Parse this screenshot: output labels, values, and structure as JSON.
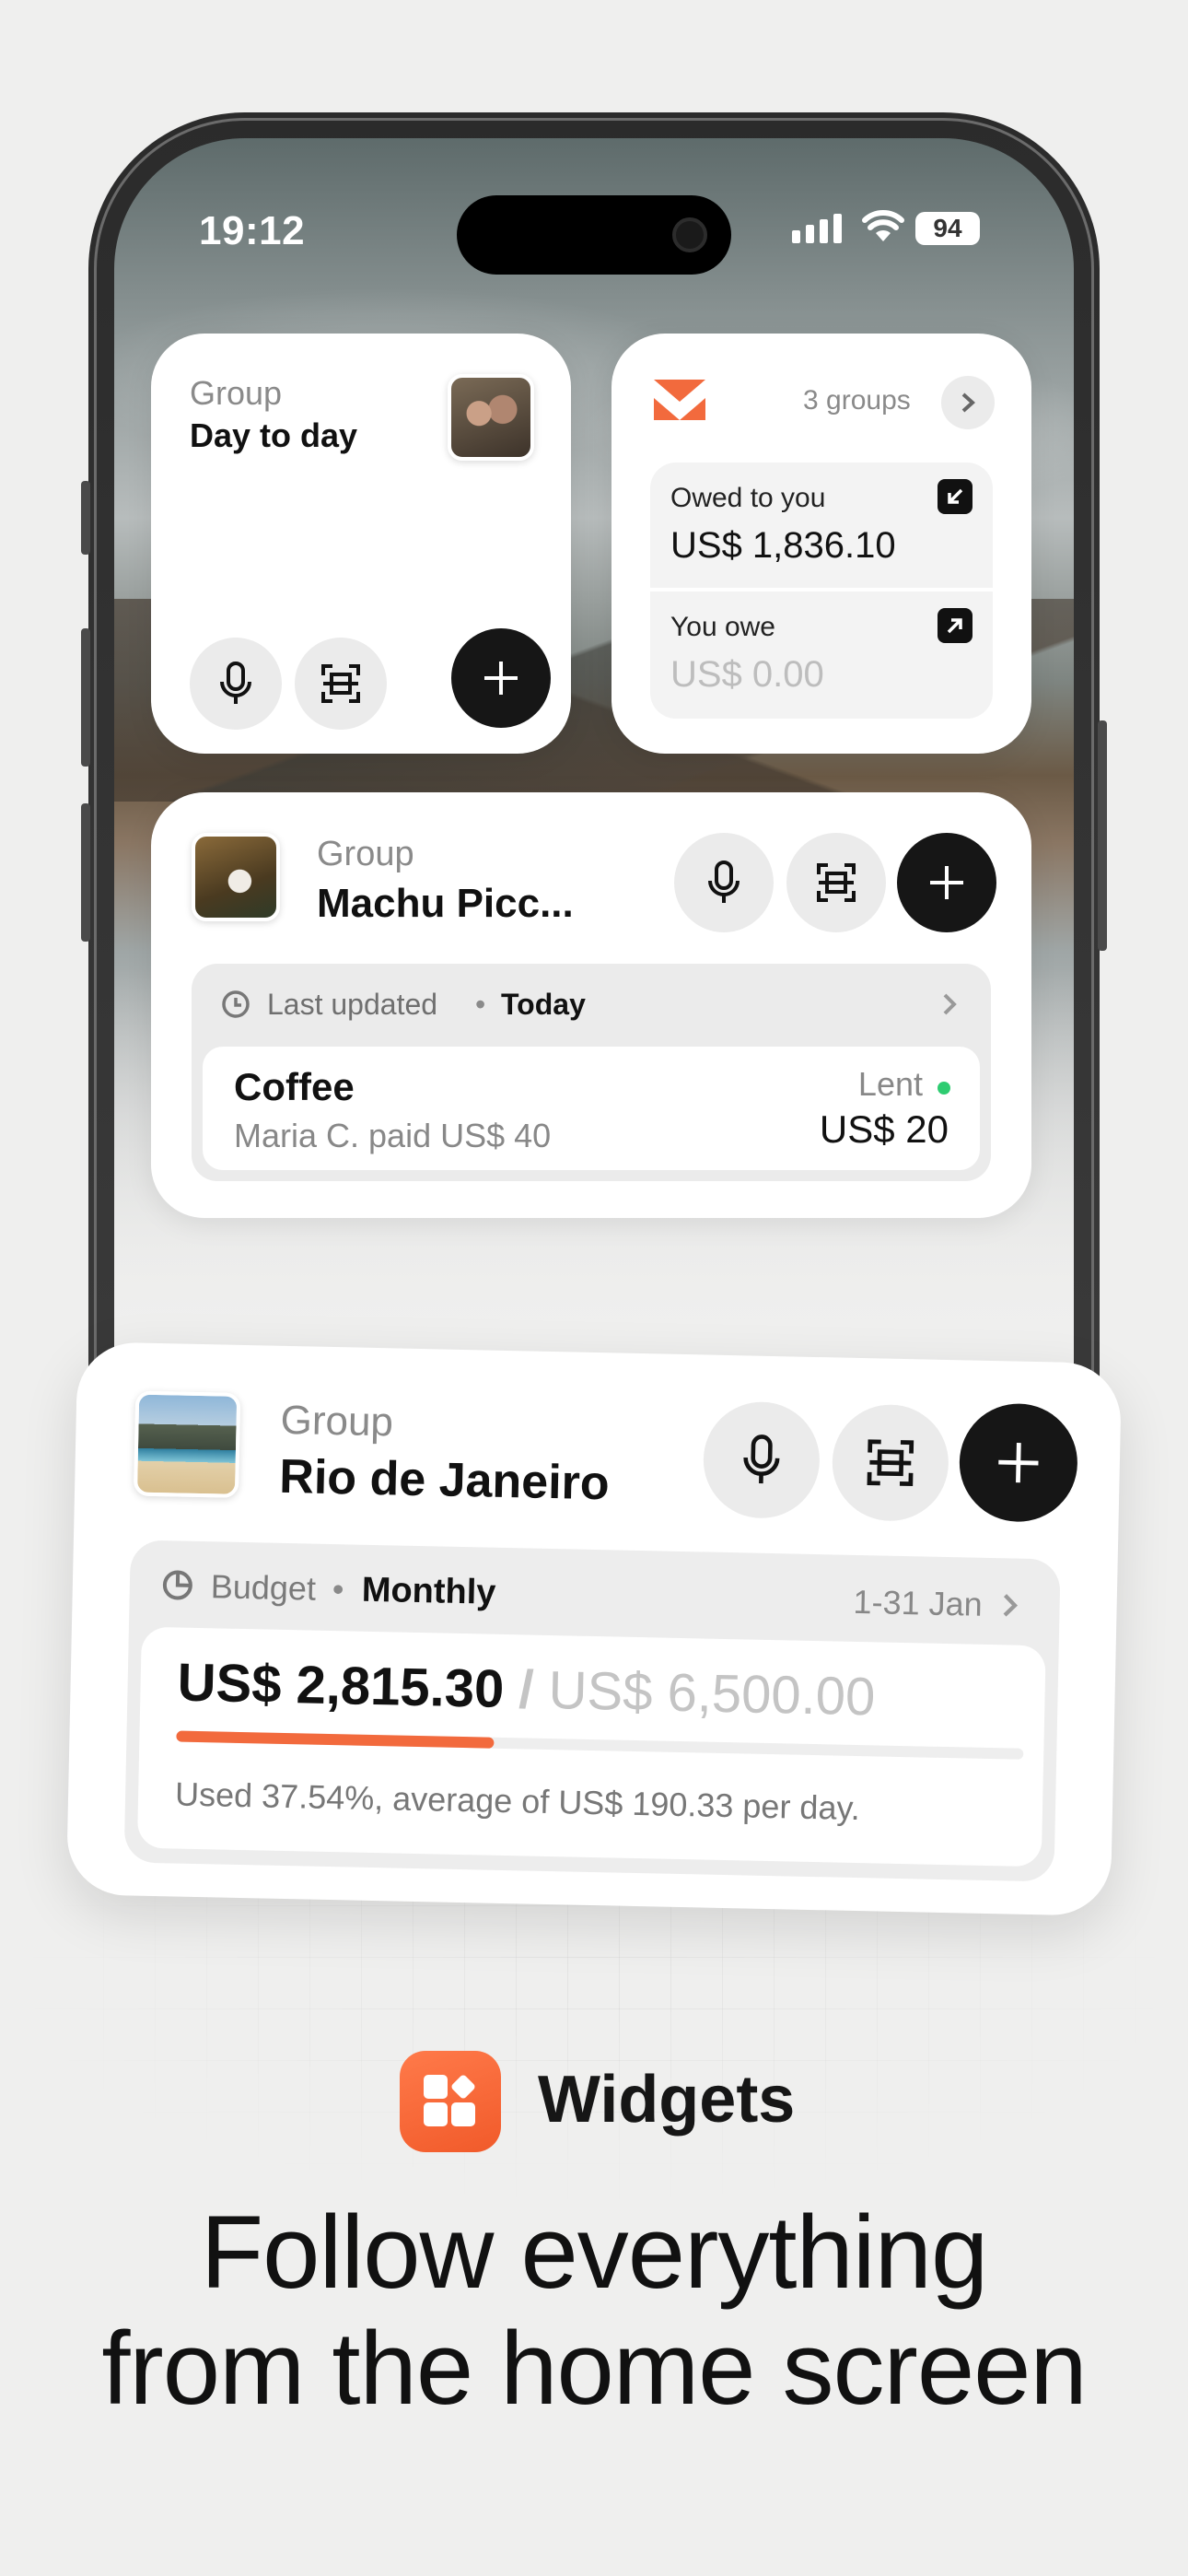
{
  "status_bar": {
    "time": "19:12",
    "battery": "94"
  },
  "widget_group_small": {
    "label": "Group",
    "name": "Day to day"
  },
  "widget_summary": {
    "groups_count": "3 groups",
    "owed_label": "Owed to you",
    "owed_amount": "US$ 1,836.10",
    "owe_label": "You owe",
    "owe_amount": "US$ 0.00"
  },
  "widget_machu": {
    "label": "Group",
    "name": "Machu Picc...",
    "last_updated_label": "Last updated",
    "last_updated_value": "Today",
    "expense": {
      "title": "Coffee",
      "subtitle": "Maria C. paid US$ 40",
      "status": "Lent",
      "amount": "US$ 20"
    }
  },
  "widget_rio": {
    "label": "Group",
    "name": "Rio de Janeiro",
    "budget_label": "Budget",
    "budget_period": "Monthly",
    "date_range": "1-31 Jan",
    "spent": "US$ 2,815.30",
    "separator": "/",
    "total": "US$ 6,500.00",
    "progress_fraction": 0.3754,
    "note": "Used 37.54%, average of US$ 190.33 per day."
  },
  "footer": {
    "brand": "Widgets",
    "headline_line1": "Follow everything",
    "headline_line2": "from the home screen"
  },
  "colors": {
    "accent": "#f26a3d",
    "positive": "#2ecc71",
    "dark": "#161616"
  }
}
